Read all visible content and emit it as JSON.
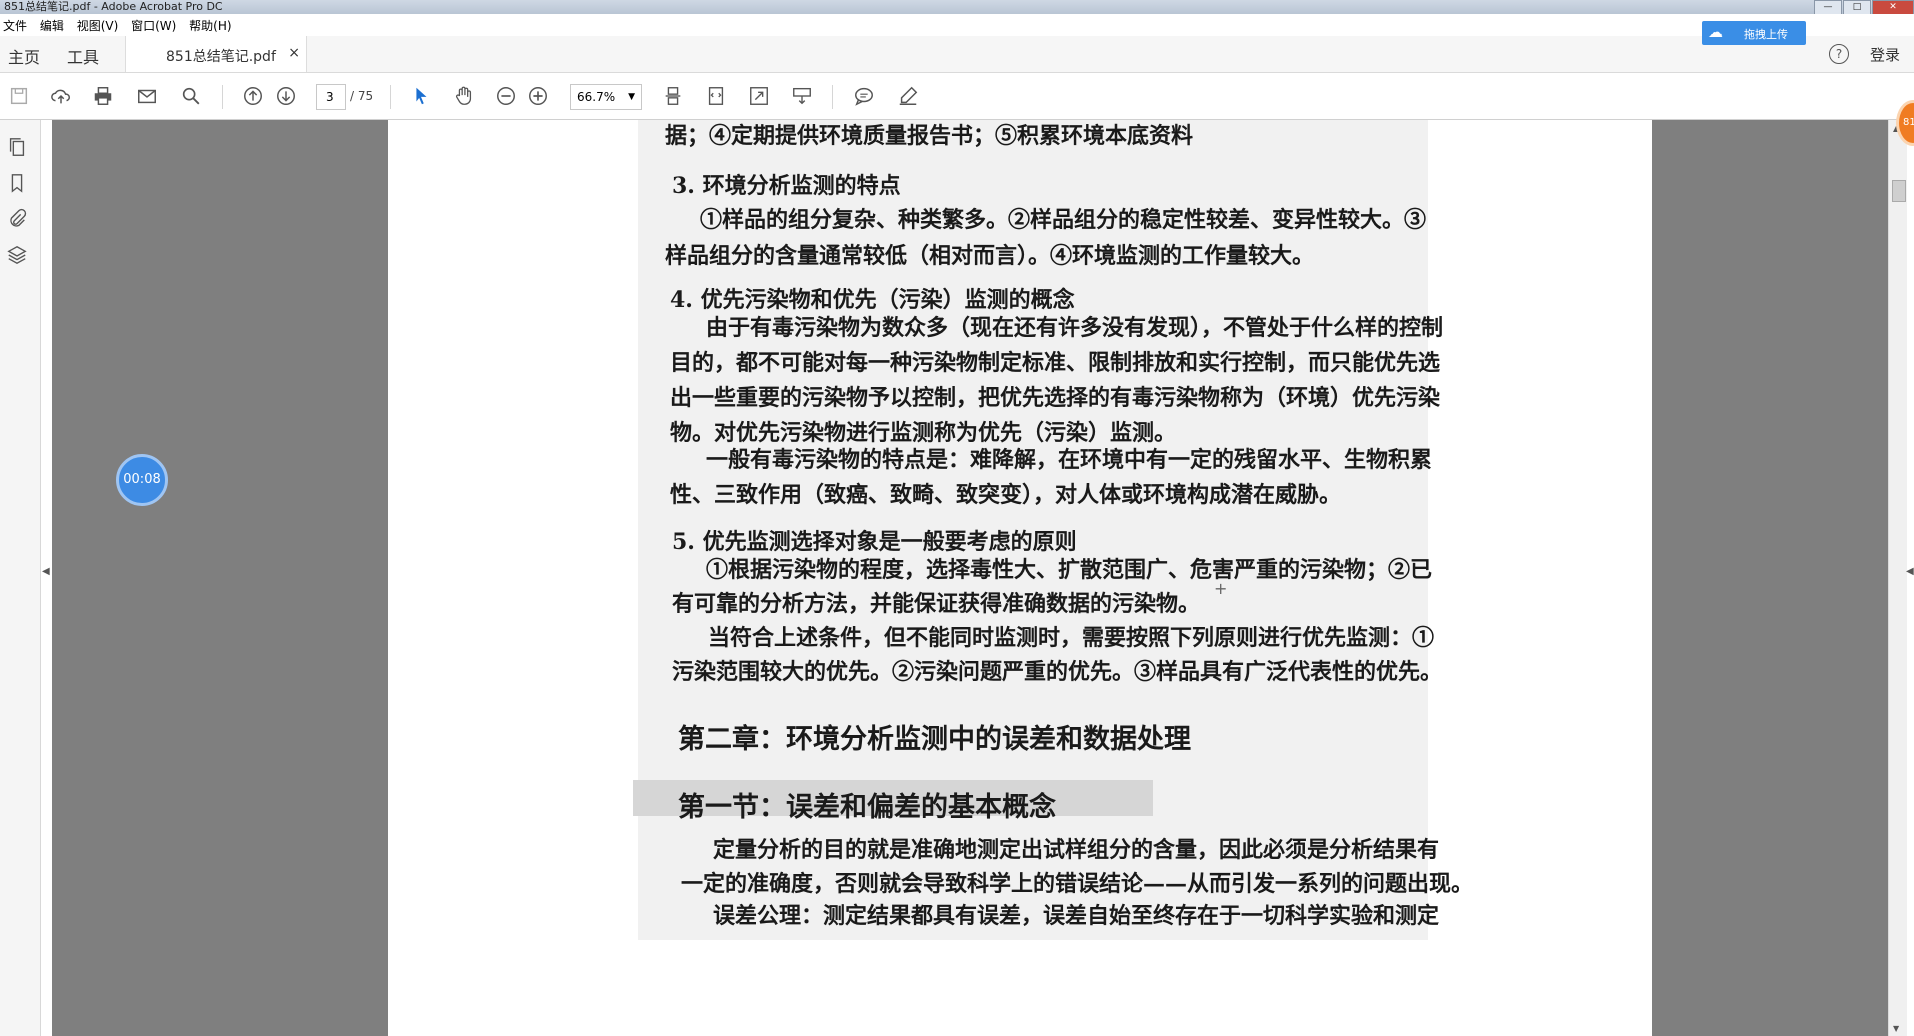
{
  "window": {
    "title": "851总结笔记.pdf - Adobe Acrobat Pro DC",
    "controls": [
      "—",
      "□",
      "✕"
    ]
  },
  "menu": [
    "文件",
    "编辑",
    "视图(V)",
    "窗口(W)",
    "帮助(H)"
  ],
  "tabs": {
    "home": "主页",
    "tools": "工具",
    "document": "851总结笔记.pdf",
    "close": "×"
  },
  "top_right": {
    "upload": "拖拽上传",
    "help": "?",
    "login": "登录"
  },
  "toolbar": {
    "current_page": "3",
    "total_pages": "/ 75",
    "zoom": "66.7%"
  },
  "timer": "00:08",
  "badge": "81",
  "document_lines": [
    "据；④定期提供环境质量报告书；⑤积累环境本底资料",
    "3. 环境分析监测的特点",
    "①样品的组分复杂、种类繁多。②样品组分的稳定性较差、变异性较大。③",
    "样品组分的含量通常较低（相对而言）。④环境监测的工作量较大。",
    "4. 优先污染物和优先（污染）监测的概念",
    "由于有毒污染物为数众多（现在还有许多没有发现），不管处于什么样的控制",
    "目的，都不可能对每一种污染物制定标准、限制排放和实行控制，而只能优先选",
    "出一些重要的污染物予以控制，把优先选择的有毒污染物称为（环境）优先污染",
    "物。对优先污染物进行监测称为优先（污染）监测。",
    "一般有毒污染物的特点是：难降解，在环境中有一定的残留水平、生物积累",
    "性、三致作用（致癌、致畸、致突变），对人体或环境构成潜在威胁。",
    "5. 优先监测选择对象是一般要考虑的原则",
    "①根据污染物的程度，选择毒性大、扩散范围广、危害严重的污染物；②已",
    "有可靠的分析方法，并能保证获得准确数据的污染物。",
    "当符合上述条件，但不能同时监测时，需要按照下列原则进行优先监测：①",
    "污染范围较大的优先。②污染问题严重的优先。③样品具有广泛代表性的优先。",
    "第二章：环境分析监测中的误差和数据处理",
    "第一节：误差和偏差的基本概念",
    "定量分析的目的就是准确地测定出试样组分的含量，因此必须是分析结果有",
    "一定的准确度，否则就会导致科学上的错误结论——从而引发一系列的问题出现。",
    "误差公理：测定结果都具有误差，误差自始至终存在于一切科学实验和测定"
  ]
}
